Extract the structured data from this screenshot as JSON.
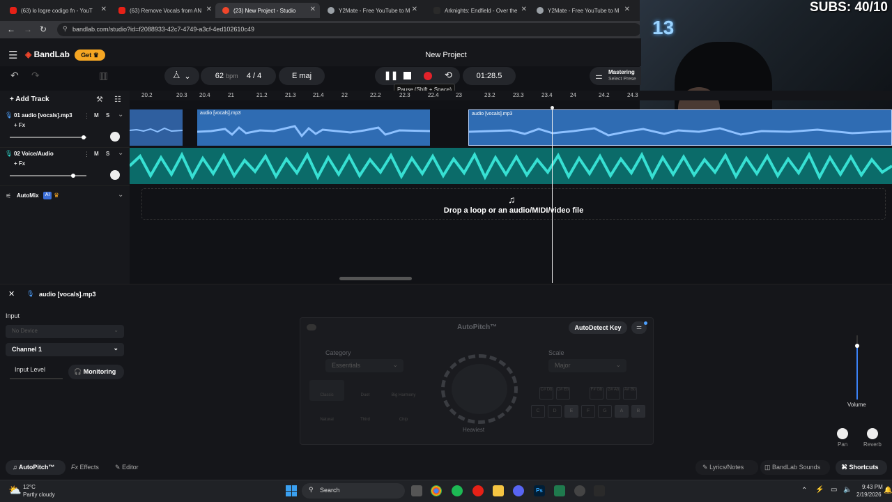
{
  "browser": {
    "tabs": [
      {
        "label": "(63) lo logre codigo fn - YouT",
        "color": "#e62117"
      },
      {
        "label": "(63) Remove Vocals from AN",
        "color": "#e62117"
      },
      {
        "label": "(23) New Project - Studio",
        "color": "#f0462b"
      },
      {
        "label": "Y2Mate - Free YouTube to M",
        "color": "#9aa0a6"
      },
      {
        "label": "Arknights: Endfield - Over the",
        "color": "#2a2a2a"
      },
      {
        "label": "Y2Mate - Free YouTube to M",
        "color": "#9aa0a6"
      }
    ],
    "url": "bandlab.com/studio?id=f2088933-42c7-4749-a3cf-4ed102610c49"
  },
  "overlay": {
    "subs": "SUBS: 40/10",
    "poster": "13"
  },
  "app": {
    "logo": "BandLab",
    "get_label": "Get",
    "project_title": "New Project",
    "bpm": "62",
    "bpm_unit": "bpm",
    "time_sig_num": "4",
    "time_sig_sep": "/",
    "time_sig_den": "4",
    "key": "E maj",
    "time": "01:28.5",
    "tooltip": "Pause (Shift + Space)",
    "mastering_title": "Mastering",
    "mastering_sub": "Select Prese",
    "add_track": "Add Track",
    "ruler": [
      "20.2",
      "20.3",
      "20.4",
      "21",
      "21.2",
      "21.3",
      "21.4",
      "22",
      "22.2",
      "22.3",
      "22.4",
      "23",
      "23.2",
      "23.3",
      "23.4",
      "24",
      "24.2",
      "24.3"
    ],
    "tracks": [
      {
        "name": "01  audio [vocals].mp3",
        "m": "M",
        "s": "S",
        "fx": "+ Fx"
      },
      {
        "name": "02  Voice/Audio",
        "m": "M",
        "s": "S",
        "fx": "+ Fx"
      }
    ],
    "clip_label": "audio [vocals].mp3",
    "automix": "AutoMix",
    "automix_badge": "AI",
    "drop_text": "Drop a loop or an audio/MIDI/video file"
  },
  "panel": {
    "title": "audio [vocals].mp3",
    "input_label": "Input",
    "device": "No Device",
    "channel": "Channel 1",
    "input_level": "Input Level",
    "monitoring": "Monitoring",
    "autopitch_title": "AutoPitch™",
    "autodetect": "AutoDetect Key",
    "category_label": "Category",
    "category_value": "Essentials",
    "scale_label": "Scale",
    "scale_value": "Major",
    "presets": [
      "Classic",
      "Duet",
      "Big Harmony",
      "Natural",
      "Third",
      "Chip"
    ],
    "knob_label": "Heaviest",
    "keys_top": [
      "C#\nDb",
      "D#\nEb",
      "F#\nGb",
      "G#\nAb",
      "A#\nBb"
    ],
    "keys_bottom": [
      "C",
      "D",
      "E",
      "F",
      "G",
      "A",
      "B"
    ],
    "volume": "Volume",
    "pan": "Pan",
    "reverb": "Reverb"
  },
  "bottombar": {
    "autopitch": "AutoPitch™",
    "effects": "Effects",
    "editor": "Editor",
    "lyrics": "Lyrics/Notes",
    "sounds": "BandLab Sounds",
    "shortcuts": "Shortcuts"
  },
  "taskbar": {
    "temp": "12°C",
    "weather": "Partly cloudy",
    "search": "Search",
    "time": "9:43 PM",
    "date": "2/19/2026"
  },
  "colors": {
    "accent": "#f5a623",
    "record": "#e3222a",
    "clip_blue": "#2f6cb3",
    "clip_teal": "#0b6b69"
  }
}
